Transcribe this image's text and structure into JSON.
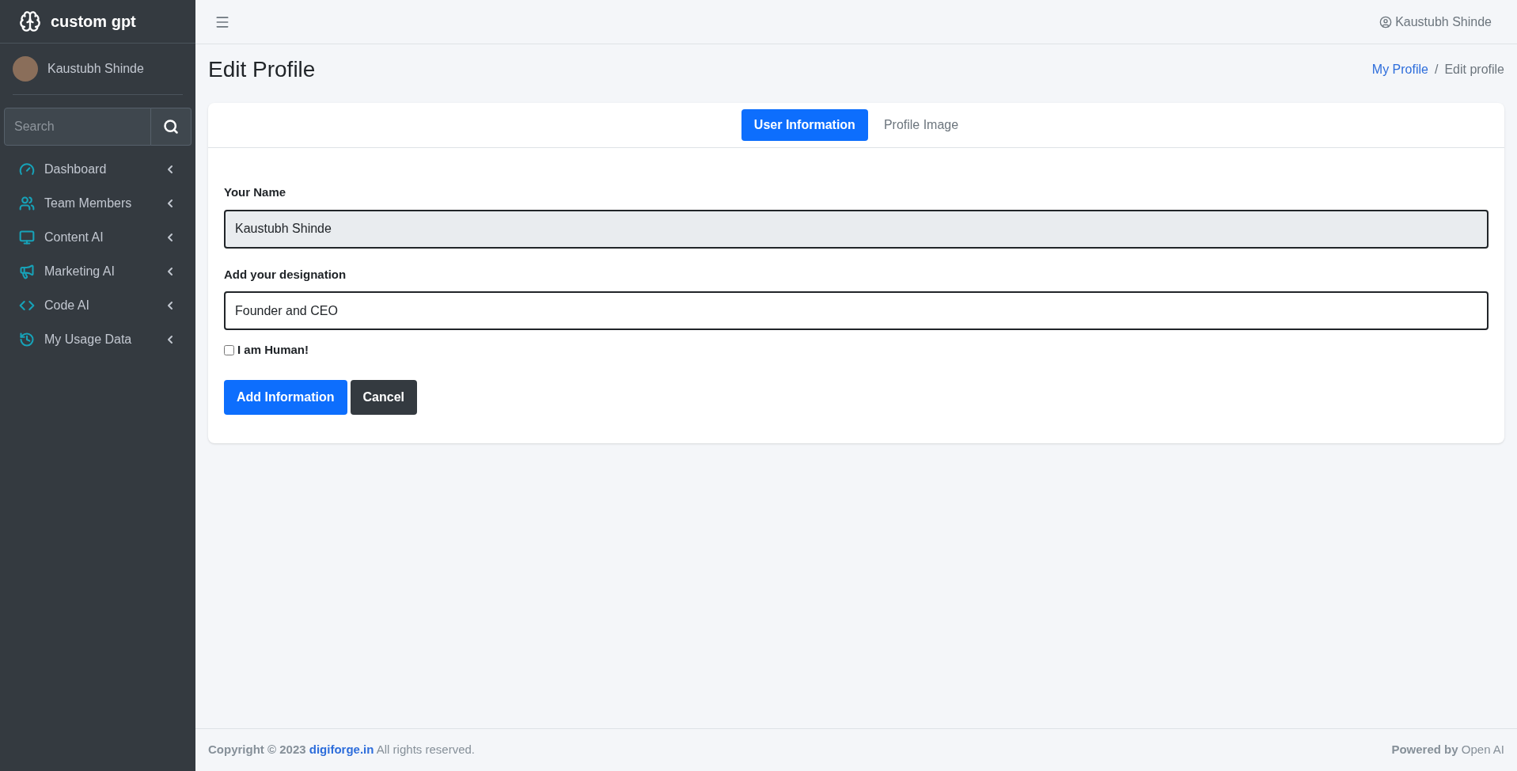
{
  "sidebar": {
    "brand": "custom gpt",
    "user": "Kaustubh Shinde",
    "search": {
      "placeholder": "Search"
    },
    "items": [
      {
        "label": "Dashboard",
        "kind": "dashboard"
      },
      {
        "label": "Team Members",
        "kind": "team"
      },
      {
        "label": "Content AI",
        "kind": "content"
      },
      {
        "label": "Marketing AI",
        "kind": "marketing"
      },
      {
        "label": "Code AI",
        "kind": "code"
      },
      {
        "label": "My Usage Data",
        "kind": "usage"
      }
    ]
  },
  "topbar": {
    "user": "Kaustubh Shinde"
  },
  "page": {
    "title": "Edit Profile",
    "breadcrumb_separator": "/",
    "breadcrumb": [
      {
        "label": "My Profile",
        "link": true
      },
      {
        "label": "Edit profile",
        "link": false
      }
    ]
  },
  "tabs": [
    {
      "label": "User Information",
      "selected": true
    },
    {
      "label": "Profile Image",
      "selected": false
    }
  ],
  "form": {
    "fields": [
      {
        "label": "Your Name",
        "value": "Kaustubh Shinde",
        "disabled": true
      },
      {
        "label": "Add your designation",
        "value": "Founder and CEO",
        "disabled": false
      }
    ],
    "checkbox": {
      "label": "I am Human!",
      "checked": false
    },
    "buttons": [
      {
        "label": "Add Information",
        "kind": "primary"
      },
      {
        "label": "Cancel",
        "kind": "secondary"
      }
    ]
  },
  "footer": {
    "copyright": "**Copyright © 2023**",
    "link": "digiforge.in",
    "rights": "All rights reserved.",
    "powered": "**Powered by** Open AI"
  }
}
